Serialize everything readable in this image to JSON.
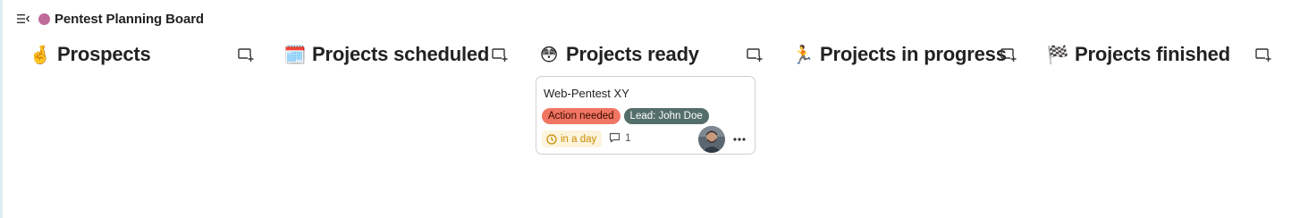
{
  "board": {
    "title": "Pentest Planning Board",
    "color": "#c06c9b"
  },
  "stacks": [
    {
      "emoji": "🤞",
      "emoji_name": "crossed-fingers-icon",
      "title": "Prospects",
      "add_icon": "add-card-icon"
    },
    {
      "emoji": "🗓️",
      "emoji_name": "calendar-icon",
      "title": "Projects scheduled",
      "add_icon": "add-card-icon"
    },
    {
      "emoji": "😳",
      "emoji_name": "flushed-face-icon",
      "title": "Projects ready",
      "add_icon": "add-card-icon"
    },
    {
      "emoji": "🏃",
      "emoji_name": "running-person-icon",
      "title": "Projects in progress",
      "add_icon": "add-card-icon"
    },
    {
      "emoji": "🏁",
      "emoji_name": "checkered-flag-icon",
      "title": "Projects finished",
      "add_icon": "add-card-icon"
    }
  ],
  "card": {
    "title": "Web-Pentest XY",
    "labels": [
      {
        "text": "Action needed",
        "color": "#f07562"
      },
      {
        "text": "Lead: John Doe",
        "color": "#546e6a"
      }
    ],
    "due": {
      "text": "in a day",
      "color": "#c98a00",
      "bg": "#fdf4dd"
    },
    "comments_count": "1"
  },
  "colors": {
    "border": "#cfcfcf",
    "icon": "#333333"
  }
}
